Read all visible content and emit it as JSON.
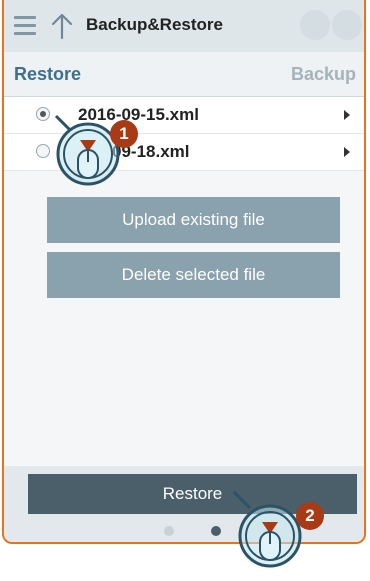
{
  "header": {
    "title": "Backup&Restore",
    "menu_icon": "hamburger-icon",
    "nav_icon": "up-arrow-icon"
  },
  "tabs": {
    "restore_label": "Restore",
    "backup_label": "Backup"
  },
  "files": [
    {
      "name": "2016-09-15.xml",
      "selected": true
    },
    {
      "name": "09-18.xml",
      "selected": false
    }
  ],
  "actions": {
    "upload_label": "Upload existing file",
    "delete_label": "Delete selected file"
  },
  "footer": {
    "restore_label": "Restore",
    "page_indicator": {
      "count": 2,
      "active": 2
    }
  },
  "steps": {
    "step1": "1",
    "step2": "2"
  },
  "colors": {
    "frame_border": "#e8731e",
    "accent": "#3e708c",
    "button_bg": "#8aa1ae",
    "primary_button_bg": "#4a5f6a",
    "step_badge": "#a83a16"
  }
}
